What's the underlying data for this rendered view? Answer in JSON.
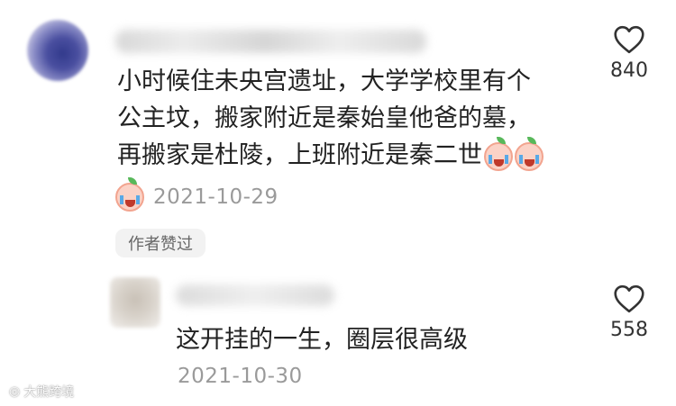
{
  "comment": {
    "lines": [
      "小时候住未央宫遗址，大学学校里有个",
      "公主坟，搬家附近是秦始皇他爸的墓，",
      "再搬家是杜陵，上班附近是秦二世"
    ],
    "date": "2021-10-29",
    "badge": "作者赞过",
    "likes": "840",
    "emoji_icon": "crying-face-emoji"
  },
  "reply": {
    "text": "这开挂的一生，圈层很高级",
    "date": "2021-10-30",
    "likes": "558"
  },
  "watermark": "大熊跨境",
  "colors": {
    "text": "#222222",
    "meta": "#9a9a9a",
    "badge_bg": "#f2f2f2"
  }
}
